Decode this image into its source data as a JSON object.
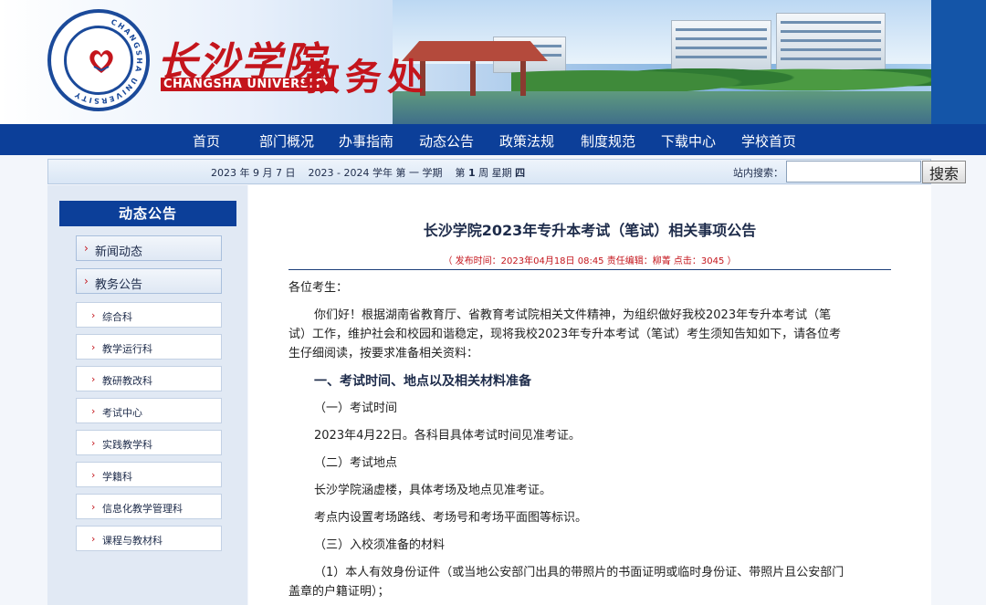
{
  "banner": {
    "school_cn": "长沙学院",
    "school_en": "CHANGSHA UNIVERSITY",
    "office": "教务处",
    "logo_ring": "CHANGSHA UNIVERSITY"
  },
  "nav": {
    "items": [
      "首页",
      "部门概况",
      "办事指南",
      "动态公告",
      "政策法规",
      "制度规范",
      "下载中心",
      "学校首页"
    ]
  },
  "info_bar": {
    "year": "2023",
    "year_unit": "年",
    "month": "9",
    "month_unit": "月",
    "day": "7",
    "day_unit": "日",
    "term_start": "2023",
    "term_sep": "-",
    "term_end": "2024",
    "term_unit": "学年",
    "term_label": "第 一 学期",
    "week_pre": "第",
    "week_num": "1",
    "week_unit": "周",
    "weekday_label": "星期",
    "weekday": "四",
    "search_label": "站内搜索：",
    "search_value": "",
    "search_button": "搜索"
  },
  "sidebar": {
    "title": "动态公告",
    "primary_items": [
      "新闻动态",
      "教务公告"
    ],
    "sub_items": [
      "综合科",
      "教学运行科",
      "教研教改科",
      "考试中心",
      "实践教学科",
      "学籍科",
      "信息化教学管理科",
      "课程与教材科"
    ]
  },
  "article": {
    "title": "长沙学院2023年专升本考试（笔试）相关事项公告",
    "meta": "（ 发布时间：2023年04月18日 08:45   责任编辑：柳菁   点击：3045 ）",
    "greeting": "各位考生：",
    "intro_l1": "你们好！根据湖南省教育厅、省教育考试院相关文件精神，为组织做好我校2023年专升本考试（笔",
    "intro_l2": "试）工作，维护社会和校园和谐稳定，现将我校2023年专升本考试（笔试）考生须知告知如下，请各位考",
    "intro_l3": "生仔细阅读，按要求准备相关资料：",
    "section1": "一、考试时间、地点以及相关材料准备",
    "sub1": "（一）考试时间",
    "sub1_text": "2023年4月22日。各科目具体考试时间见准考证。",
    "sub2": "（二）考试地点",
    "sub2_text1": "长沙学院涵虚楼，具体考场及地点见准考证。",
    "sub2_text2": "考点内设置考场路线、考场号和考场平面图等标识。",
    "sub3": "（三）入校须准备的材料",
    "item1_l1": "（1）本人有效身份证件（或当地公安部门出具的带照片的书面证明或临时身份证、带照片且公安部门",
    "item1_l2": "盖章的户籍证明）；"
  }
}
